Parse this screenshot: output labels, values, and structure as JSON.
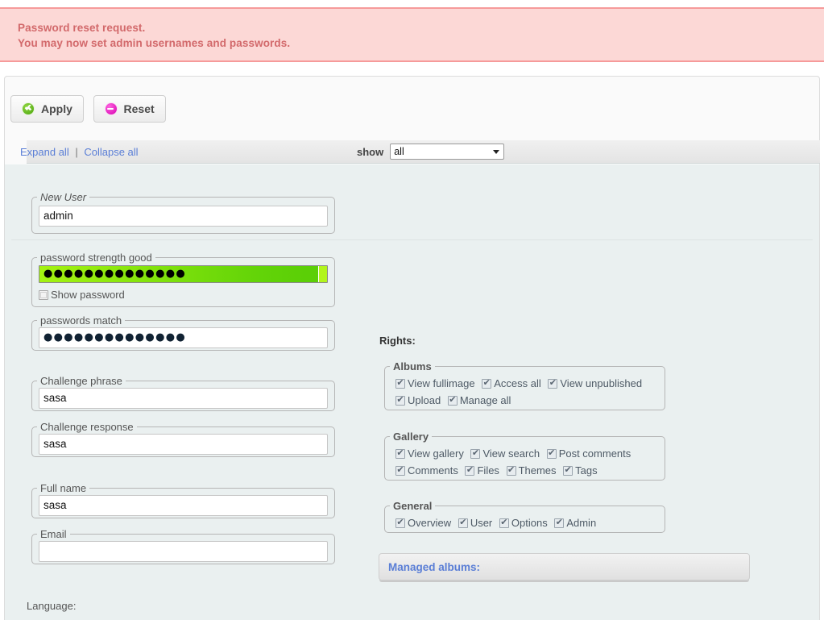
{
  "alert": {
    "line1": "Password reset request.",
    "line2": "You may now set admin usernames and passwords.",
    "bg_color": "#fcd8d6",
    "border_color": "#f69a9a",
    "text_color": "#d2696b"
  },
  "toolbar": {
    "apply_label": "Apply",
    "apply_icon": "green-check-circle-icon",
    "reset_label": "Reset",
    "reset_icon": "magenta-minus-circle-icon"
  },
  "exbar": {
    "expand_all": "Expand all",
    "separator": "|",
    "collapse_all": "Collapse all",
    "show_label": "show",
    "show_value": "all",
    "show_options": [
      "all"
    ]
  },
  "form": {
    "new_user": {
      "legend": "New User",
      "value": "admin"
    },
    "password": {
      "legend": "password strength good",
      "value": "●●●●●●●●●●●●●●",
      "strength_percent": 97,
      "strength_color": "#63d408",
      "show_password_label": "Show password",
      "show_password_checked": false
    },
    "password_confirm": {
      "legend": "passwords match",
      "value": "●●●●●●●●●●●●●●"
    },
    "challenge_phrase": {
      "legend": "Challenge phrase",
      "value": "sasa"
    },
    "challenge_response": {
      "legend": "Challenge response",
      "value": "sasa"
    },
    "full_name": {
      "legend": "Full name",
      "value": "sasa"
    },
    "email": {
      "legend": "Email",
      "value": ""
    },
    "language_label": "Language:"
  },
  "rights": {
    "title": "Rights:",
    "groups": [
      {
        "legend": "Albums",
        "rows": [
          [
            {
              "label": "View fullimage",
              "checked": true
            },
            {
              "label": "Access all",
              "checked": true
            },
            {
              "label": "View unpublished",
              "checked": true
            }
          ],
          [
            {
              "label": "Upload",
              "checked": true
            },
            {
              "label": "Manage all",
              "checked": true
            }
          ]
        ]
      },
      {
        "legend": "Gallery",
        "rows": [
          [
            {
              "label": "View gallery",
              "checked": true
            },
            {
              "label": "View search",
              "checked": true
            },
            {
              "label": "Post comments",
              "checked": true
            }
          ],
          [
            {
              "label": "Comments",
              "checked": true
            },
            {
              "label": "Files",
              "checked": true
            },
            {
              "label": "Themes",
              "checked": true
            },
            {
              "label": "Tags",
              "checked": true
            }
          ]
        ]
      },
      {
        "legend": "General",
        "rows": [
          [
            {
              "label": "Overview",
              "checked": true
            },
            {
              "label": "User",
              "checked": true
            },
            {
              "label": "Options",
              "checked": true
            },
            {
              "label": "Admin",
              "checked": true
            }
          ]
        ]
      }
    ],
    "managed_albums_label": "Managed albums:"
  }
}
